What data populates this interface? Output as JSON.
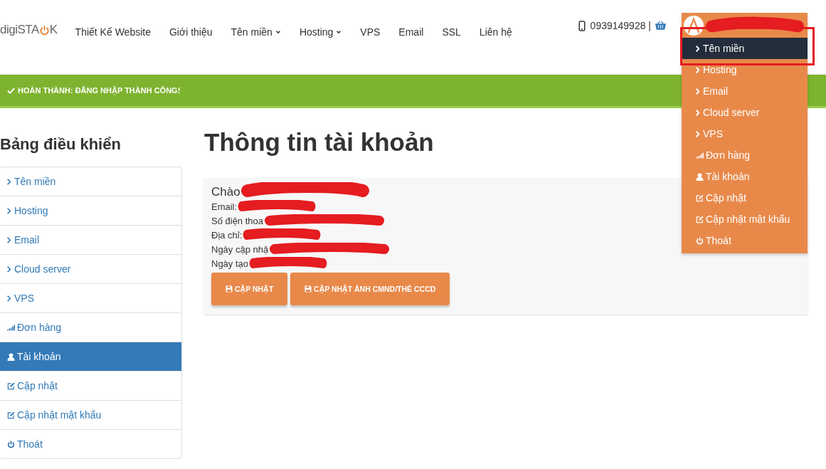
{
  "header": {
    "logo": {
      "before": "digiSTA",
      "after": "K"
    },
    "nav": [
      {
        "label": "Thiết Kế Website",
        "dropdown": false
      },
      {
        "label": "Giới thiệu",
        "dropdown": false
      },
      {
        "label": "Tên miền",
        "dropdown": true
      },
      {
        "label": "Hosting",
        "dropdown": true
      },
      {
        "label": "VPS",
        "dropdown": false
      },
      {
        "label": "Email",
        "dropdown": false
      },
      {
        "label": "SSL",
        "dropdown": false
      },
      {
        "label": "Liên hệ",
        "dropdown": false
      }
    ],
    "phone": "0939149928 |"
  },
  "user_menu": {
    "items": [
      {
        "kind": "chevron",
        "label": "Tên miền",
        "selected": true
      },
      {
        "kind": "chevron",
        "label": "Hosting",
        "selected": false
      },
      {
        "kind": "chevron",
        "label": "Email",
        "selected": false
      },
      {
        "kind": "chevron",
        "label": "Cloud server",
        "selected": false
      },
      {
        "kind": "chevron",
        "label": "VPS",
        "selected": false
      },
      {
        "kind": "signal",
        "label": "Đơn hàng",
        "selected": false
      },
      {
        "kind": "user",
        "label": "Tài khoản",
        "selected": false
      },
      {
        "kind": "edit",
        "label": "Cập nhật",
        "selected": false
      },
      {
        "kind": "edit",
        "label": "Cập nhật mật khẩu",
        "selected": false
      },
      {
        "kind": "power",
        "label": "Thoát",
        "selected": false
      }
    ]
  },
  "alert": "HOÀN THÀNH: ĐĂNG NHẬP THÀNH CÔNG!",
  "sidebar": {
    "title": "Bảng điều khiển",
    "items": [
      {
        "kind": "chevron",
        "label": "Tên miền",
        "selected": false
      },
      {
        "kind": "chevron",
        "label": "Hosting",
        "selected": false
      },
      {
        "kind": "chevron",
        "label": "Email",
        "selected": false
      },
      {
        "kind": "chevron",
        "label": "Cloud server",
        "selected": false
      },
      {
        "kind": "chevron",
        "label": "VPS",
        "selected": false
      },
      {
        "kind": "signal",
        "label": "Đơn hàng",
        "selected": false
      },
      {
        "kind": "user",
        "label": "Tài khoản",
        "selected": true
      },
      {
        "kind": "edit",
        "label": "Cập nhật",
        "selected": false
      },
      {
        "kind": "edit",
        "label": "Cập nhật mật khẩu",
        "selected": false
      },
      {
        "kind": "power",
        "label": "Thoát",
        "selected": false
      }
    ]
  },
  "main": {
    "title": "Thông tin tài khoản",
    "greeting": "Chào",
    "fields": [
      "Email:",
      "Số điện thoa",
      "Địa chỉ:",
      "Ngày cập nhậ",
      "Ngày tạo"
    ],
    "buttons": [
      "CẬP NHẬT",
      "CẬP NHẬT ẢNH CMND/THẺ CCCD"
    ]
  }
}
